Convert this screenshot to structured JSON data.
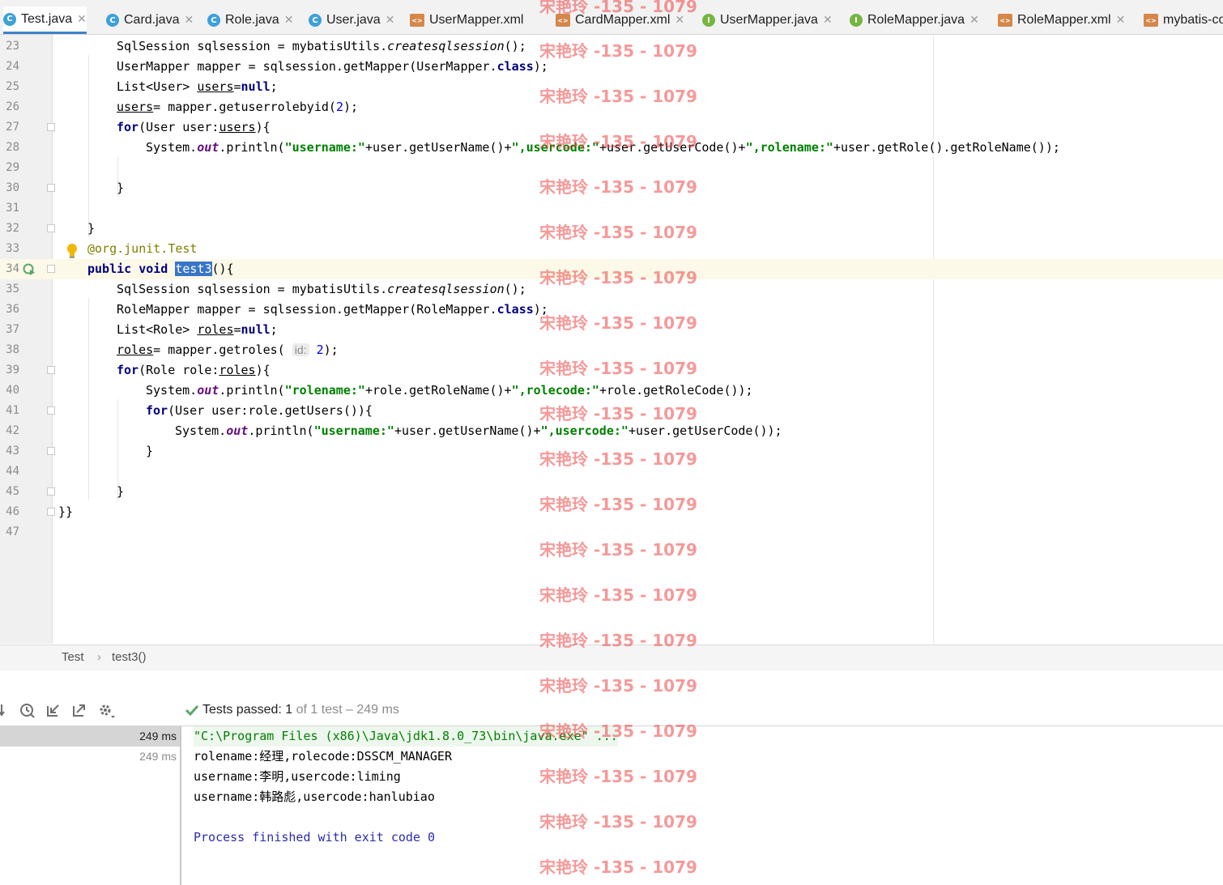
{
  "tabs": [
    {
      "label": "Test.java",
      "icon": "class-icon",
      "active": true
    },
    {
      "label": "Card.java",
      "icon": "class-icon"
    },
    {
      "label": "Role.java",
      "icon": "class-icon"
    },
    {
      "label": "User.java",
      "icon": "class-icon"
    },
    {
      "label": "UserMapper.xml",
      "icon": "xml-file-icon"
    },
    {
      "label": "CardMapper.xml",
      "icon": "xml-file-icon"
    },
    {
      "label": "UserMapper.java",
      "icon": "interface-icon"
    },
    {
      "label": "RoleMapper.java",
      "icon": "interface-icon"
    },
    {
      "label": "RoleMapper.xml",
      "icon": "xml-file-icon"
    },
    {
      "label": "mybatis-co",
      "icon": "xml-file-icon"
    }
  ],
  "editor": {
    "line_numbers": [
      "23",
      "24",
      "25",
      "26",
      "27",
      "28",
      "29",
      "30",
      "31",
      "32",
      "33",
      "34",
      "35",
      "36",
      "37",
      "38",
      "39",
      "40",
      "41",
      "42",
      "43",
      "44",
      "45",
      "46",
      "47"
    ],
    "t": {
      "sqlsession": "SqlSession",
      "sqlsessionVar": " sqlsession = mybatisUtils.",
      "createsqlsession": "createsqlsession",
      "paren_end": "();",
      "userMapperDecl": "UserMapper mapper = sqlsession.getMapper(UserMapper.",
      "roleMapperDecl": "RoleMapper mapper = sqlsession.getMapper(RoleMapper.",
      "class": "class",
      "paren_semi": ");",
      "listUser": "List<User> ",
      "listRole": "List<Role> ",
      "users": "users",
      "roles": "roles",
      "eq": "=",
      "null": "null",
      "semi": ";",
      "eq_mapper_getuserrolebyid": "= mapper.getuserrolebyid(",
      "eq_mapper_getroles": "= mapper.getroles(",
      "hint_id": "id:",
      "two": "2",
      "for": "for",
      "forUser": "(User user:",
      "forRole": "(Role role:",
      "close_brace_open": "){",
      "systemDot": "System.",
      "out": "out",
      "printlnOpen": ".println(",
      "s_username": "\"username:\"",
      "s_usercode": "\",usercode:\"",
      "s_rolename_after": "\",rolename:\"",
      "s_rolename": "\"rolename:\"",
      "s_rolecode": "\",rolecode:\"",
      "plusUserGetUserName": "+user.getUserName()+",
      "plusUserGetUserCode_cont": "+user.getUserCode()+",
      "plusUserGetRoleName": "+user.getRole().getRoleName());",
      "plusRoleGetRoleName": "+role.getRoleName()+",
      "plusRoleGetRoleCode": "+role.getRoleCode());",
      "plusUserGetUserCode_end": "+user.getUserCode());",
      "forUserRoleUsers": "(User user:role.getUsers()){",
      "brace_close": "}",
      "annotation": "@org.junit.",
      "annotationTest": "Test",
      "public": "public",
      "void": "void",
      "test3": "test3",
      "paren_brace": "(){",
      "double_close": "}}"
    }
  },
  "breadcrumb": {
    "class": "Test",
    "separator": "›",
    "method": "test3()"
  },
  "run": {
    "status_prefix": "Tests passed:",
    "passed_count": "1",
    "status_suffix": "of 1 test – 249 ms",
    "tree": [
      "249 ms",
      "249 ms"
    ],
    "console": [
      "\"C:\\Program Files (x86)\\Java\\jdk1.8.0_73\\bin\\java.exe\" ...",
      "rolename:经理,rolecode:DSSCM_MANAGER",
      "username:李明,usercode:liming",
      "username:韩路彪,usercode:hanlubiao",
      "",
      "Process finished with exit code 0"
    ]
  },
  "watermark": "宋艳玲 -135 - 1079"
}
